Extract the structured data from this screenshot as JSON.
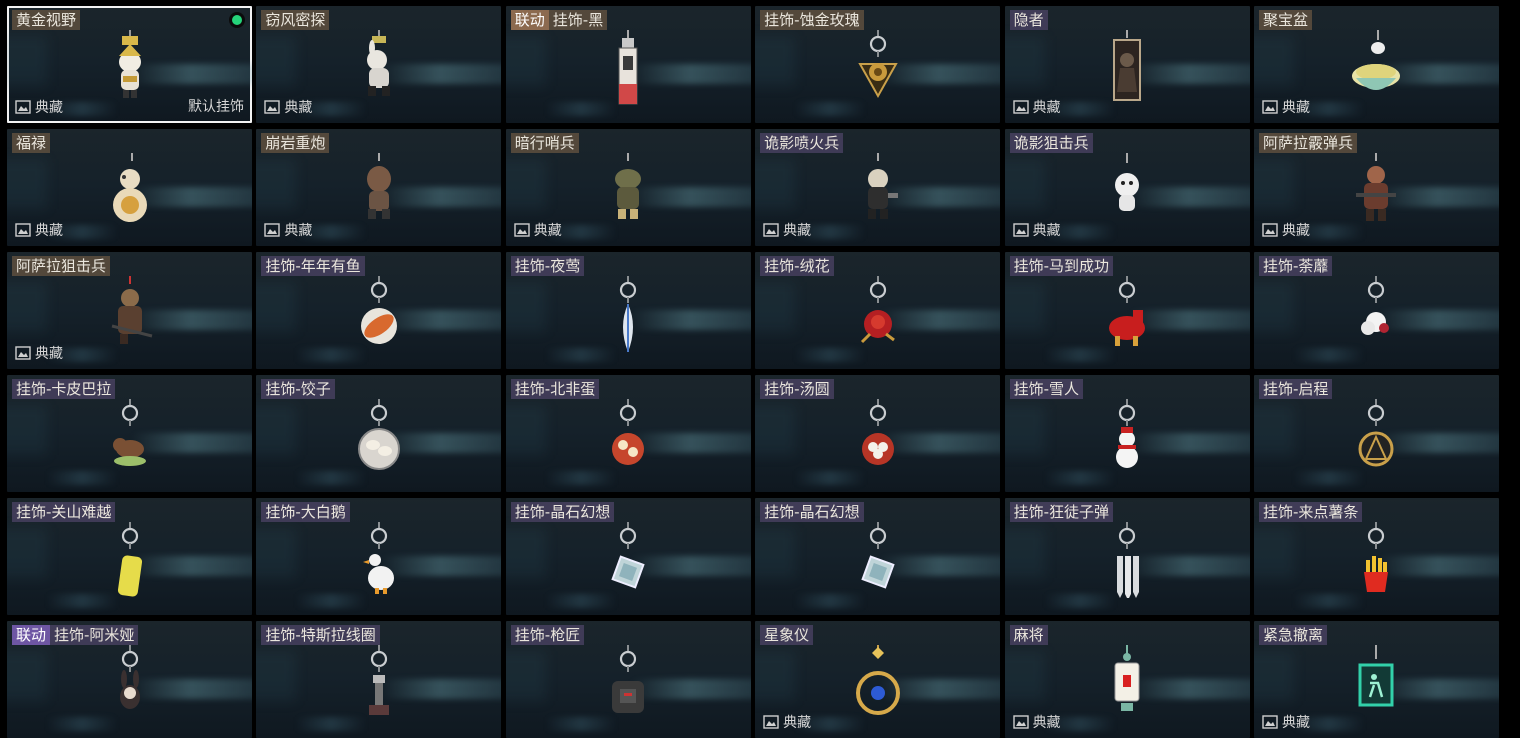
{
  "default_label": "默认挂饰",
  "collection_label": "典藏",
  "accent_colors": {
    "selected_border": "#f2f2f2",
    "equipped_dot": "#25d37a",
    "collab_tag_brown": "#8c6a4f",
    "collab_tag_purple": "#6e56a3"
  },
  "items": [
    {
      "name": "黄金视野",
      "tone": 1,
      "collab": "",
      "collection": true,
      "selected": true,
      "equipped": true,
      "is_default": true,
      "icon": "golden-charm-figure"
    },
    {
      "name": "窃风密探",
      "tone": 1,
      "collab": "",
      "collection": true,
      "icon": "white-rabbit-figure"
    },
    {
      "name": "挂饰-黑",
      "tone": 1,
      "collab": "联动",
      "collab_tone": 1,
      "collection": false,
      "icon": "tag-charm"
    },
    {
      "name": "挂饰-蚀金玫瑰",
      "tone": 1,
      "collab": "",
      "collection": false,
      "icon": "gold-rose-pendant"
    },
    {
      "name": "隐者",
      "tone": 2,
      "collab": "",
      "collection": true,
      "icon": "tarot-card"
    },
    {
      "name": "聚宝盆",
      "tone": 1,
      "collab": "",
      "collection": true,
      "icon": "treasure-bowl"
    },
    {
      "name": "福禄",
      "tone": 1,
      "collab": "",
      "collection": true,
      "icon": "gourd-figure"
    },
    {
      "name": "崩岩重炮",
      "tone": 1,
      "collab": "",
      "collection": true,
      "icon": "brown-soldier-figure"
    },
    {
      "name": "暗行哨兵",
      "tone": 1,
      "collab": "",
      "collection": true,
      "icon": "camo-soldier-figure"
    },
    {
      "name": "诡影喷火兵",
      "tone": 2,
      "collab": "",
      "collection": true,
      "icon": "flamethrower-figure"
    },
    {
      "name": "诡影狙击兵",
      "tone": 2,
      "collab": "",
      "collection": true,
      "icon": "sniper-ghost-figure"
    },
    {
      "name": "阿萨拉霰弹兵",
      "tone": 1,
      "collab": "",
      "collection": true,
      "icon": "shotgunner-figure"
    },
    {
      "name": "阿萨拉狙击兵",
      "tone": 1,
      "collab": "",
      "collection": true,
      "icon": "sniper-figure"
    },
    {
      "name": "挂饰-年年有鱼",
      "tone": 2,
      "collab": "",
      "collection": false,
      "icon": "fish-plate"
    },
    {
      "name": "挂饰-夜莺",
      "tone": 2,
      "collab": "",
      "collection": false,
      "icon": "feather"
    },
    {
      "name": "挂饰-绒花",
      "tone": 2,
      "collab": "",
      "collection": false,
      "icon": "red-rose"
    },
    {
      "name": "挂饰-马到成功",
      "tone": 2,
      "collab": "",
      "collection": false,
      "icon": "red-horse"
    },
    {
      "name": "挂饰-荼蘼",
      "tone": 2,
      "collab": "",
      "collection": false,
      "icon": "white-flower"
    },
    {
      "name": "挂饰-卡皮巴拉",
      "tone": 2,
      "collab": "",
      "collection": false,
      "icon": "capybara"
    },
    {
      "name": "挂饰-饺子",
      "tone": 2,
      "collab": "",
      "collection": false,
      "icon": "dumpling-plate"
    },
    {
      "name": "挂饰-北非蛋",
      "tone": 2,
      "collab": "",
      "collection": false,
      "icon": "shakshuka"
    },
    {
      "name": "挂饰-汤圆",
      "tone": 2,
      "collab": "",
      "collection": false,
      "icon": "tangyuan-bowl"
    },
    {
      "name": "挂饰-雪人",
      "tone": 2,
      "collab": "",
      "collection": false,
      "icon": "snowman"
    },
    {
      "name": "挂饰-启程",
      "tone": 2,
      "collab": "",
      "collection": false,
      "icon": "compass-medal"
    },
    {
      "name": "挂饰-关山难越",
      "tone": 2,
      "collab": "",
      "collection": false,
      "icon": "yellow-lighter"
    },
    {
      "name": "挂饰-大白鹅",
      "tone": 2,
      "collab": "",
      "collection": false,
      "icon": "white-goose"
    },
    {
      "name": "挂饰-晶石幻想",
      "tone": 2,
      "collab": "",
      "collection": false,
      "icon": "crystal-cube"
    },
    {
      "name": "挂饰-晶石幻想",
      "tone": 2,
      "collab": "",
      "collection": false,
      "icon": "crystal-cube"
    },
    {
      "name": "挂饰-狂徒子弹",
      "tone": 2,
      "collab": "",
      "collection": false,
      "icon": "bullets"
    },
    {
      "name": "挂饰-来点薯条",
      "tone": 2,
      "collab": "",
      "collection": false,
      "icon": "fries"
    },
    {
      "name": "挂饰-阿米娅",
      "tone": 2,
      "collab": "联动",
      "collab_tone": 2,
      "collection": false,
      "icon": "bunny-figure"
    },
    {
      "name": "挂饰-特斯拉线圈",
      "tone": 2,
      "collab": "",
      "collection": false,
      "icon": "tesla-coil"
    },
    {
      "name": "挂饰-枪匠",
      "tone": 2,
      "collab": "",
      "collection": false,
      "icon": "backpack"
    },
    {
      "name": "星象仪",
      "tone": 2,
      "collab": "",
      "collection": true,
      "icon": "astrolabe"
    },
    {
      "name": "麻将",
      "tone": 2,
      "collab": "",
      "collection": true,
      "icon": "mahjong-tile"
    },
    {
      "name": "紧急撤离",
      "tone": 2,
      "collab": "",
      "collection": true,
      "icon": "exit-sign"
    }
  ]
}
